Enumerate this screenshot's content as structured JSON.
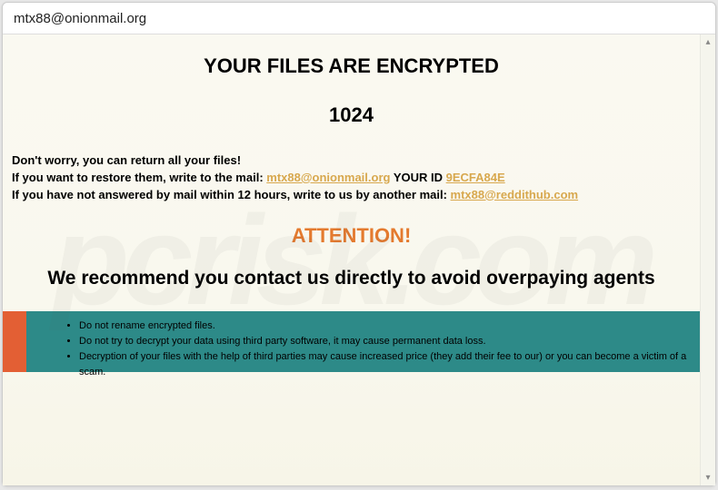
{
  "window": {
    "title": "mtx88@onionmail.org"
  },
  "headings": {
    "encrypted": "YOUR FILES ARE ENCRYPTED",
    "number": "1024",
    "attention": "ATTENTION!",
    "recommend": "We recommend you contact us directly to avoid overpaying agents"
  },
  "body": {
    "line1": "Don't worry, you can return all your files!",
    "line2_prefix": "If you want to restore them, write to the mail:   ",
    "email1": "mtx88@onionmail.org",
    "line2_mid": "   YOUR ID ",
    "your_id": "9ECFA84E",
    "line3_prefix": "If you have not answered by mail within 12 hours, write to us by another mail:  ",
    "email2": "mtx88@reddithub.com"
  },
  "warnings": {
    "item1": "Do not rename encrypted files.",
    "item2": "Do not try to decrypt your data using third party software, it may cause permanent data loss.",
    "item3": "Decryption of your files with the help of third parties may cause increased price (they add their fee to our) or you can become a victim of a scam."
  },
  "scrollbar": {
    "up": "▴",
    "down": "▾"
  },
  "watermark": "pcrisk.com"
}
